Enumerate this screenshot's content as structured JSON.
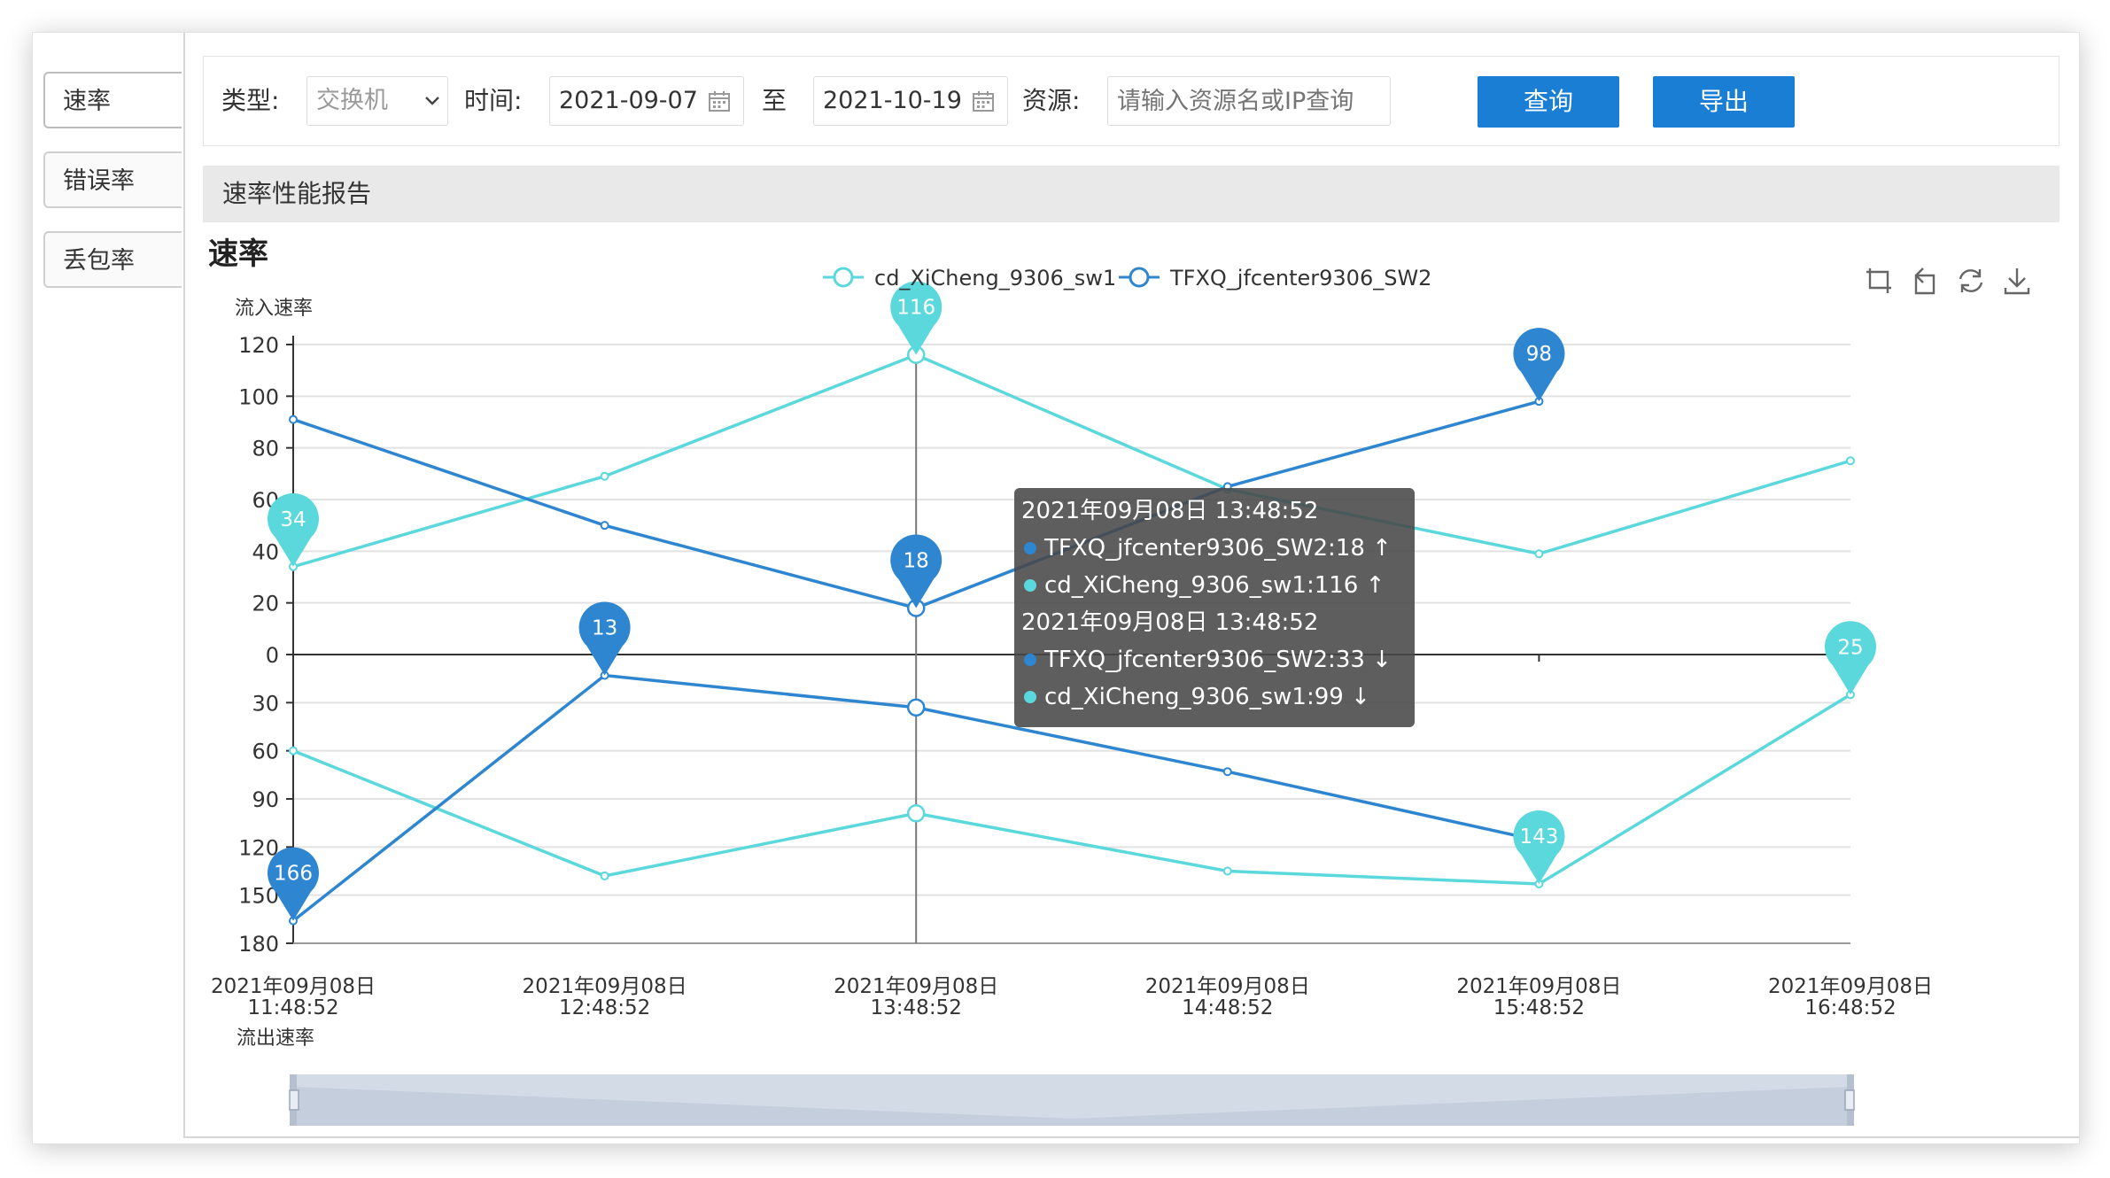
{
  "tabs": [
    {
      "label": "速率"
    },
    {
      "label": "错误率"
    },
    {
      "label": "丢包率"
    }
  ],
  "filter": {
    "type_label": "类型:",
    "type_value": "交换机",
    "time_label": "时间:",
    "date_from": "2021-09-07",
    "to_label": "至",
    "date_to": "2021-10-19",
    "resource_label": "资源:",
    "resource_placeholder": "请输入资源名或IP查询",
    "query_button": "查询",
    "export_button": "导出"
  },
  "report": {
    "header": "速率性能报告",
    "chart_title": "速率"
  },
  "colors": {
    "series1": "#5ad8dc",
    "series2": "#2f86d0",
    "button": "#1a7fd4"
  },
  "toolbox_icons": [
    "zoom-select-icon",
    "zoom-reset-icon",
    "restore-icon",
    "save-image-icon"
  ],
  "tooltip": {
    "lines": [
      {
        "kind": "header",
        "text": "2021年09月08日 13:48:52"
      },
      {
        "kind": "item",
        "series": "series2",
        "text": "TFXQ_jfcenter9306_SW2:18 ↑"
      },
      {
        "kind": "item",
        "series": "series1",
        "text": "cd_XiCheng_9306_sw1:116 ↑"
      },
      {
        "kind": "header",
        "text": "2021年09月08日 13:48:52"
      },
      {
        "kind": "item",
        "series": "series2",
        "text": "TFXQ_jfcenter9306_SW2:33 ↓"
      },
      {
        "kind": "item",
        "series": "series1",
        "text": "cd_XiCheng_9306_sw1:99 ↓"
      }
    ]
  },
  "chart_data": {
    "type": "line",
    "title": "速率",
    "legend": [
      "cd_XiCheng_9306_sw1",
      "TFXQ_jfcenter9306_SW2"
    ],
    "legend_position": "top-center",
    "categories": [
      [
        "2021年09月08日",
        "11:48:52"
      ],
      [
        "2021年09月08日",
        "12:48:52"
      ],
      [
        "2021年09月08日",
        "13:48:52"
      ],
      [
        "2021年09月08日",
        "14:48:52"
      ],
      [
        "2021年09月08日",
        "15:48:52"
      ],
      [
        "2021年09月08日",
        "16:48:52"
      ]
    ],
    "inflow": {
      "label": "流入速率",
      "ticks": [
        "0",
        "20",
        "40",
        "60",
        "80",
        "100",
        "120"
      ],
      "range": [
        0,
        120
      ],
      "series": [
        {
          "name": "cd_XiCheng_9306_sw1",
          "color": "#5ad8dc",
          "values": [
            34,
            69,
            116,
            64,
            39,
            75
          ],
          "marks": [
            {
              "index": 0,
              "label": "34"
            },
            {
              "index": 2,
              "label": "116"
            }
          ]
        },
        {
          "name": "TFXQ_jfcenter9306_SW2",
          "color": "#2f86d0",
          "values": [
            91,
            50,
            18,
            65,
            98
          ],
          "marks": [
            {
              "index": 2,
              "label": "18"
            },
            {
              "index": 4,
              "label": "98"
            }
          ]
        }
      ]
    },
    "outflow": {
      "label": "流出速率",
      "ticks": [
        "30",
        "60",
        "90",
        "120",
        "150",
        "180"
      ],
      "range": [
        0,
        180
      ],
      "series": [
        {
          "name": "cd_XiCheng_9306_sw1",
          "color": "#5ad8dc",
          "values": [
            60,
            138,
            99,
            135,
            143,
            25
          ],
          "marks": [
            {
              "index": 4,
              "label": "143"
            },
            {
              "index": 5,
              "label": "25"
            }
          ]
        },
        {
          "name": "TFXQ_jfcenter9306_SW2",
          "color": "#2f86d0",
          "values": [
            166,
            13,
            33,
            73,
            116
          ],
          "marks": [
            {
              "index": 0,
              "label": "166"
            },
            {
              "index": 1,
              "label": "13"
            }
          ]
        }
      ]
    },
    "grid": true
  }
}
